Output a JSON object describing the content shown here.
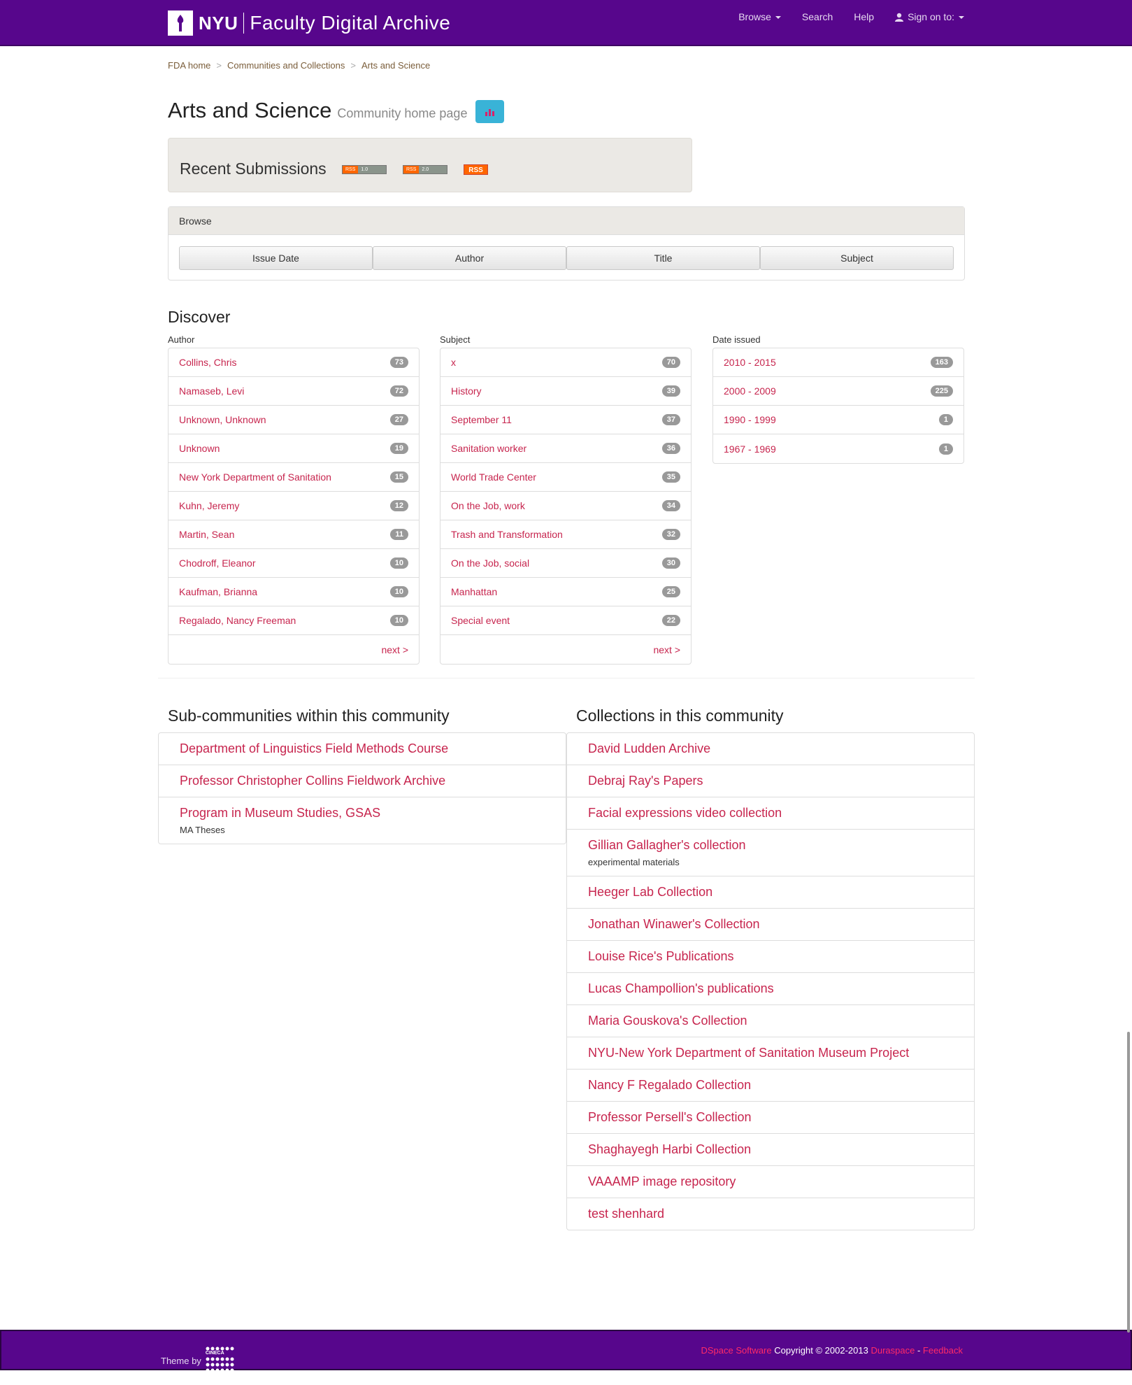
{
  "header": {
    "brand_nyu": "NYU",
    "brand_fda": "Faculty Digital Archive",
    "nav": {
      "browse": "Browse",
      "search": "Search",
      "help": "Help",
      "signin": "Sign on to:"
    }
  },
  "breadcrumb": {
    "home": "FDA home",
    "communities": "Communities and Collections",
    "current": "Arts and Science"
  },
  "title": {
    "main": "Arts and Science",
    "sub": "Community home page"
  },
  "recent": {
    "title": "Recent Submissions",
    "rss1_l": "RSS",
    "rss1_r": "1.0",
    "rss2_l": "RSS",
    "rss2_r": "2.0",
    "rss3": "RSS"
  },
  "browse": {
    "heading": "Browse",
    "buttons": [
      "Issue Date",
      "Author",
      "Title",
      "Subject"
    ]
  },
  "discover": {
    "title": "Discover",
    "author": {
      "label": "Author",
      "items": [
        {
          "name": "Collins, Chris",
          "count": "73"
        },
        {
          "name": "Namaseb, Levi",
          "count": "72"
        },
        {
          "name": "Unknown, Unknown",
          "count": "27"
        },
        {
          "name": "Unknown",
          "count": "19"
        },
        {
          "name": "New York Department of Sanitation",
          "count": "15"
        },
        {
          "name": "Kuhn, Jeremy",
          "count": "12"
        },
        {
          "name": "Martin, Sean",
          "count": "11"
        },
        {
          "name": "Chodroff, Eleanor",
          "count": "10"
        },
        {
          "name": "Kaufman, Brianna",
          "count": "10"
        },
        {
          "name": "Regalado, Nancy Freeman",
          "count": "10"
        }
      ],
      "next": "next >"
    },
    "subject": {
      "label": "Subject",
      "items": [
        {
          "name": "x",
          "count": "70"
        },
        {
          "name": "History",
          "count": "39"
        },
        {
          "name": "September 11",
          "count": "37"
        },
        {
          "name": "Sanitation worker",
          "count": "36"
        },
        {
          "name": "World Trade Center",
          "count": "35"
        },
        {
          "name": "On the Job, work",
          "count": "34"
        },
        {
          "name": "Trash and Transformation",
          "count": "32"
        },
        {
          "name": "On the Job, social",
          "count": "30"
        },
        {
          "name": "Manhattan",
          "count": "25"
        },
        {
          "name": "Special event",
          "count": "22"
        }
      ],
      "next": "next >"
    },
    "date": {
      "label": "Date issued",
      "items": [
        {
          "name": "2010 - 2015",
          "count": "163"
        },
        {
          "name": "2000 - 2009",
          "count": "225"
        },
        {
          "name": "1990 - 1999",
          "count": "1"
        },
        {
          "name": "1967 - 1969",
          "count": "1"
        }
      ]
    }
  },
  "subcommunities": {
    "title": "Sub-communities within this community",
    "items": [
      {
        "name": "Department of Linguistics Field Methods Course",
        "desc": ""
      },
      {
        "name": "Professor Christopher Collins Fieldwork Archive",
        "desc": ""
      },
      {
        "name": "Program in Museum Studies, GSAS",
        "desc": "MA Theses"
      }
    ]
  },
  "collections": {
    "title": "Collections in this community",
    "items": [
      {
        "name": "David Ludden Archive",
        "desc": ""
      },
      {
        "name": "Debraj Ray's Papers",
        "desc": ""
      },
      {
        "name": "Facial expressions video collection",
        "desc": ""
      },
      {
        "name": "Gillian Gallagher's collection",
        "desc": "experimental materials"
      },
      {
        "name": "Heeger Lab Collection",
        "desc": ""
      },
      {
        "name": "Jonathan Winawer's Collection",
        "desc": ""
      },
      {
        "name": "Louise Rice's Publications",
        "desc": ""
      },
      {
        "name": "Lucas Champollion's publications",
        "desc": ""
      },
      {
        "name": "Maria Gouskova's Collection",
        "desc": ""
      },
      {
        "name": "NYU-New York Department of Sanitation Museum Project",
        "desc": ""
      },
      {
        "name": "Nancy F Regalado Collection",
        "desc": ""
      },
      {
        "name": "Professor Persell's Collection",
        "desc": ""
      },
      {
        "name": "Shaghayegh Harbi Collection",
        "desc": ""
      },
      {
        "name": "VAAAMP image repository",
        "desc": ""
      },
      {
        "name": "test shenhard",
        "desc": ""
      }
    ]
  },
  "footer": {
    "theme_by": "Theme by",
    "cineca": "CINECA",
    "dspace": "DSpace Software",
    "copyright": " Copyright © 2002-2013 ",
    "duraspace": "Duraspace",
    "dash": " - ",
    "feedback": "Feedback"
  },
  "colors": {
    "brand_purple": "#57068c",
    "link": "#c7254e",
    "panel_bg": "#ebe9e5"
  }
}
